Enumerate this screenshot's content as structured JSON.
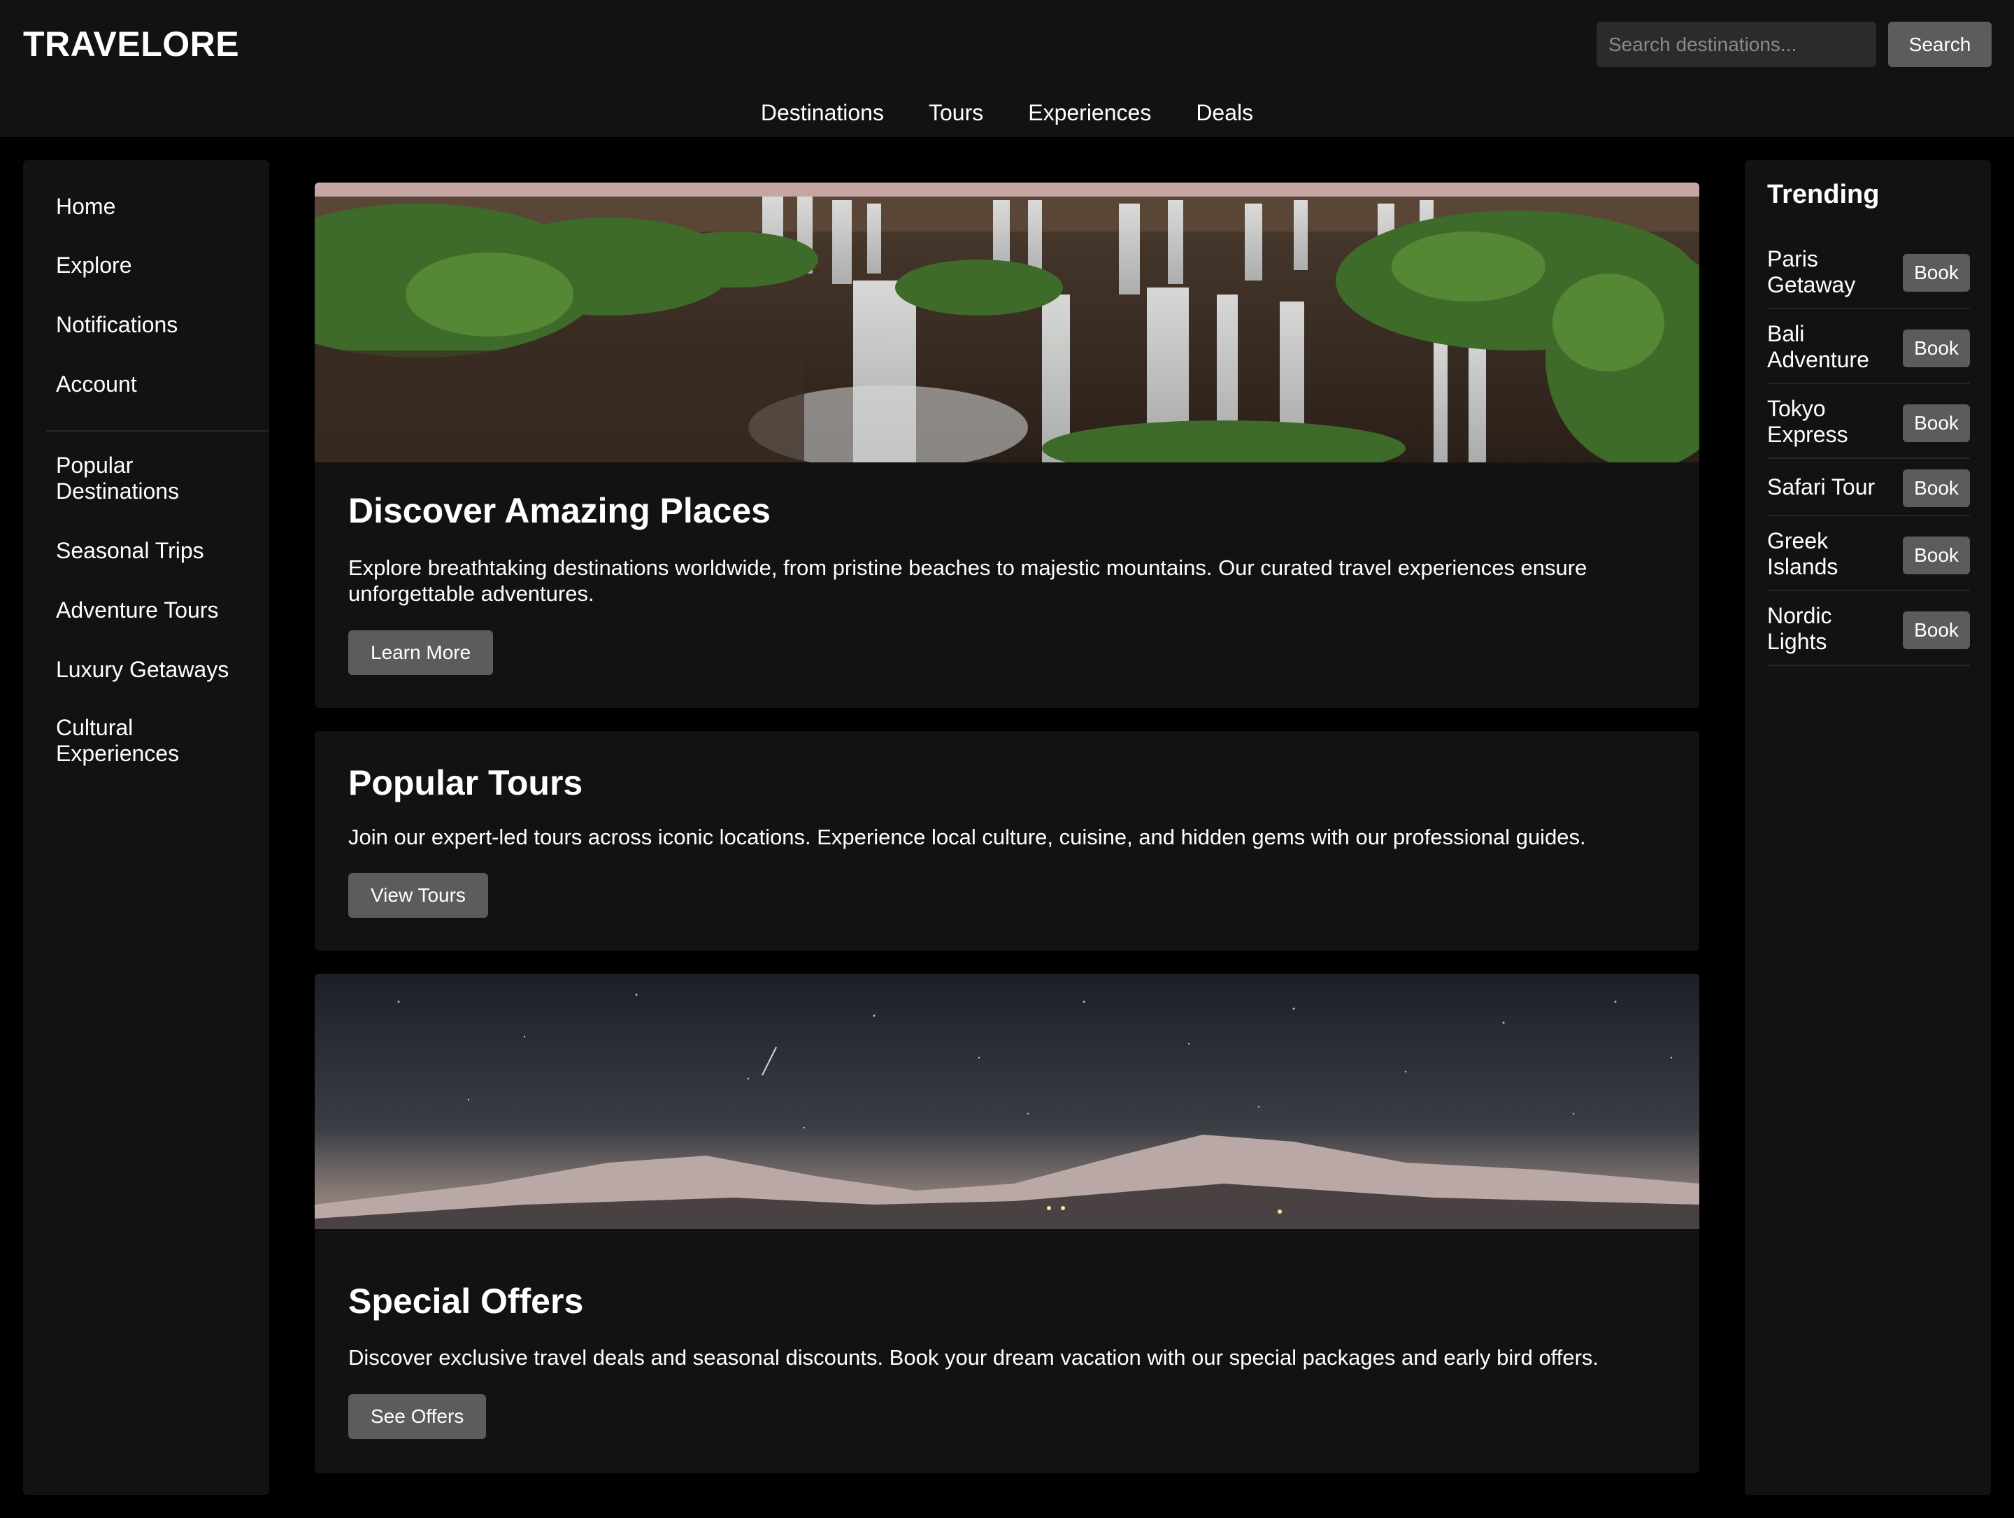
{
  "header": {
    "logo": "TRAVELORE",
    "search_placeholder": "Search destinations...",
    "search_button": "Search",
    "nav": [
      "Destinations",
      "Tours",
      "Experiences",
      "Deals"
    ]
  },
  "sidebar": {
    "primary": [
      "Home",
      "Explore",
      "Notifications",
      "Account"
    ],
    "secondary": [
      "Popular Destinations",
      "Seasonal Trips",
      "Adventure Tours",
      "Luxury Getaways",
      "Cultural Experiences"
    ]
  },
  "cards": [
    {
      "title": "Discover Amazing Places",
      "text": "Explore breathtaking destinations worldwide, from pristine beaches to majestic mountains. Our curated travel experiences ensure unforgettable adventures.",
      "button": "Learn More"
    },
    {
      "title": "Popular Tours",
      "text": "Join our expert-led tours across iconic locations. Experience local culture, cuisine, and hidden gems with our professional guides.",
      "button": "View Tours"
    },
    {
      "title": "Special Offers",
      "text": "Discover exclusive travel deals and seasonal discounts. Book your dream vacation with our special packages and early bird offers.",
      "button": "See Offers"
    }
  ],
  "trending": {
    "title": "Trending",
    "button_label": "Book",
    "items": [
      "Paris Getaway",
      "Bali Adventure",
      "Tokyo Express",
      "Safari Tour",
      "Greek Islands",
      "Nordic Lights"
    ]
  },
  "colors": {
    "page_bg": "#000000",
    "panel_bg": "#121212",
    "button_bg": "#5c5c5c",
    "input_bg": "#2b2b2b"
  }
}
